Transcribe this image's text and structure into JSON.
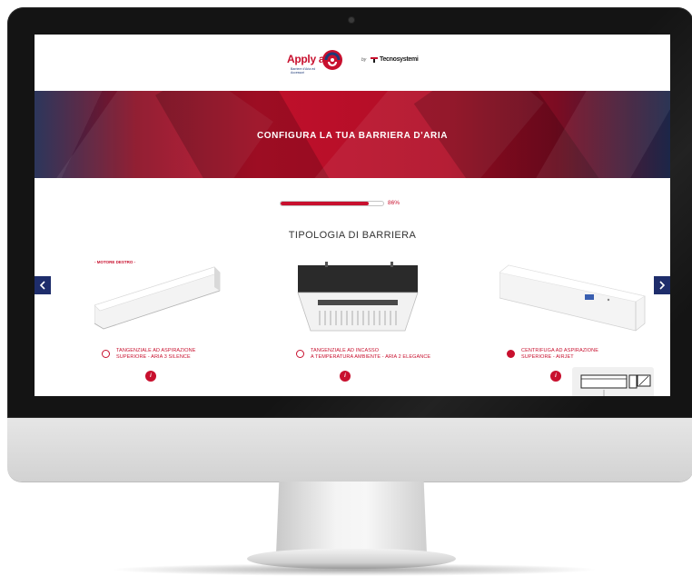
{
  "brand": {
    "name": "Apply air",
    "tagline": "Barriere d'Aria ed Accessori",
    "by": "by",
    "partner": "Tecnosystemi"
  },
  "hero": {
    "title": "CONFIGURA LA TUA BARRIERA D'ARIA"
  },
  "progress": {
    "value": 0.86,
    "label": "86%"
  },
  "section": {
    "title": "TIPOLOGIA DI BARRIERA"
  },
  "products": [
    {
      "tag": "- MOTORE DESTRO -",
      "caption_line1": "TANGENZIALE AD ASPIRAZIONE",
      "caption_line2": "SUPERIORE - ARIA 3 SILENCE",
      "selected": false,
      "info": "i"
    },
    {
      "tag": "",
      "caption_line1": "TANGENZIALE AD INCASSO",
      "caption_line2": "A TEMPERATURA AMBIENTE - ARIA 2 ELEGANCE",
      "selected": false,
      "info": "i"
    },
    {
      "tag": "",
      "caption_line1": "CENTRIFUGA AD ASPIRAZIONE",
      "caption_line2": "SUPERIORE - AIRJET",
      "selected": true,
      "info": "i"
    }
  ],
  "nav": {
    "prev_icon": "chevron-left-icon",
    "next_icon": "chevron-right-icon"
  },
  "colors": {
    "accent": "#c8102e",
    "navy": "#1e2d6b"
  }
}
